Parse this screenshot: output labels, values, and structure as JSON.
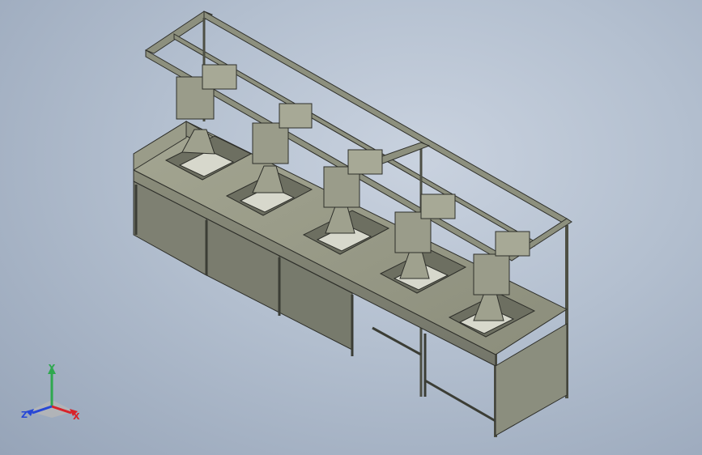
{
  "viewport": {
    "background_top": "#c9d2df",
    "background_bottom": "#96a4b8"
  },
  "model": {
    "description_icon": "cad-assembly",
    "station_count": 5,
    "colors": {
      "frame": "#8a8d7c",
      "frame_dark": "#5b5d50",
      "panel": "#8f917f",
      "panel_light": "#a9ab99",
      "panel_dark": "#6d6f60",
      "edge": "#2e2f2a"
    }
  },
  "triad": {
    "x_label": "X",
    "y_label": "Y",
    "z_label": "Z",
    "x_color": "#d8232a",
    "y_color": "#2fa84f",
    "z_color": "#2747d6"
  }
}
